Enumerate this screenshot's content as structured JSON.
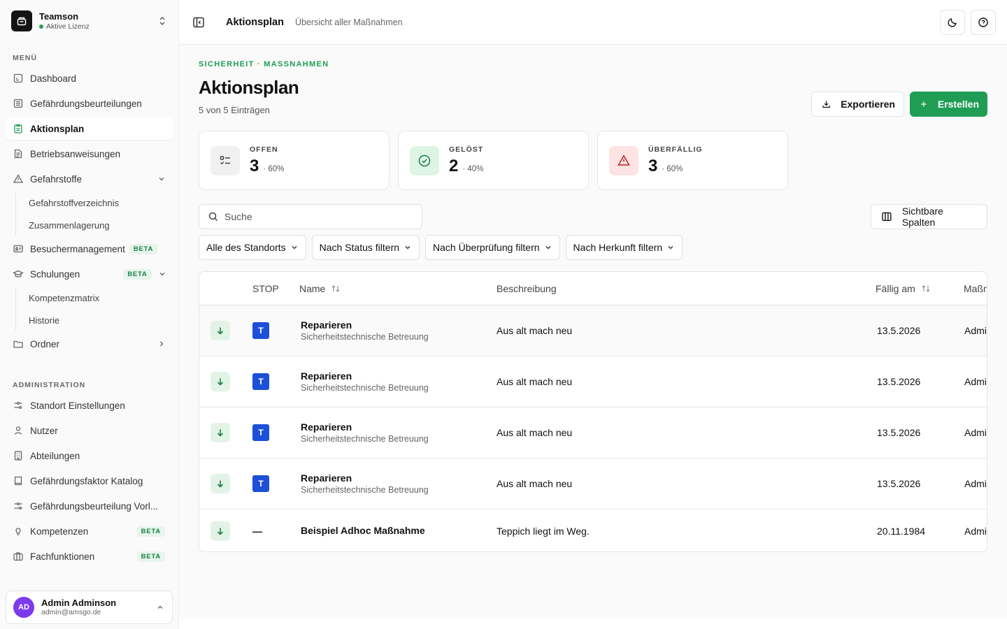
{
  "team": {
    "name": "Teamson",
    "status": "Aktive Lizenz"
  },
  "sidebar": {
    "menu_label": "MENÜ",
    "admin_label": "ADMINISTRATION",
    "menu": [
      {
        "label": "Dashboard",
        "icon": "dashboard-icon"
      },
      {
        "label": "Gefährdungsbeurteilungen",
        "icon": "document-list-icon"
      },
      {
        "label": "Aktionsplan",
        "icon": "clipboard-icon",
        "active": true
      },
      {
        "label": "Betriebsanweisungen",
        "icon": "file-text-icon"
      },
      {
        "label": "Gefahrstoffe",
        "icon": "warning-icon",
        "expanded": true
      },
      {
        "label": "Gefahrstoffverzeichnis"
      },
      {
        "label": "Zusammenlagerung"
      },
      {
        "label": "Besuchermanagement",
        "icon": "id-card-icon",
        "badge": "BETA"
      },
      {
        "label": "Schulungen",
        "icon": "graduation-cap-icon",
        "badge": "BETA",
        "expanded": true
      },
      {
        "label": "Kompetenzmatrix"
      },
      {
        "label": "Historie"
      },
      {
        "label": "Ordner",
        "icon": "folder-icon"
      }
    ],
    "admin": [
      {
        "label": "Standort Einstellungen",
        "icon": "sliders-icon"
      },
      {
        "label": "Nutzer",
        "icon": "user-icon"
      },
      {
        "label": "Abteilungen",
        "icon": "building-icon"
      },
      {
        "label": "Gefährdungsfaktor Katalog",
        "icon": "book-icon"
      },
      {
        "label": "Gefährdungsbeurteilung Vorl...",
        "icon": "sliders-icon"
      },
      {
        "label": "Kompetenzen",
        "icon": "lightbulb-icon",
        "badge": "BETA"
      },
      {
        "label": "Fachfunktionen",
        "icon": "briefcase-icon",
        "badge": "BETA"
      }
    ]
  },
  "user": {
    "initials": "AD",
    "name": "Admin Adminson",
    "email": "admin@amsgo.de",
    "avatar_color": "#7c3aed"
  },
  "header": {
    "title": "Aktionsplan",
    "subtitle": "Übersicht aller Maßnahmen"
  },
  "page": {
    "eyebrow": "SICHERHEIT · MASSNAHMEN",
    "title": "Aktionsplan",
    "count": "5 von 5 Einträgen",
    "export_label": "Exportieren",
    "create_label": "Erstellen",
    "columns_label": "Sichtbare Spalten"
  },
  "stats": [
    {
      "label": "OFFEN",
      "value": "3",
      "pct": "· 60%",
      "icon": "checklist-icon"
    },
    {
      "label": "GELÖST",
      "value": "2",
      "pct": "· 40%",
      "icon": "check-circle-icon"
    },
    {
      "label": "ÜBERFÄLLIG",
      "value": "3",
      "pct": "· 60%",
      "icon": "alert-triangle-icon"
    }
  ],
  "search": {
    "placeholder": "Suche"
  },
  "filters": [
    "Alle des Standorts",
    "Nach Status filtern",
    "Nach Überprüfung filtern",
    "Nach Herkunft filtern"
  ],
  "table": {
    "headers": {
      "stop": "STOP",
      "name": "Name",
      "description": "Beschreibung",
      "due": "Fällig am",
      "measure": "Maßn"
    },
    "rows": [
      {
        "stop": "T",
        "name": "Reparieren",
        "sub": "Sicherheitstechnische Betreuung",
        "description": "Aus alt mach neu",
        "due": "13.5.2026",
        "measure": "Admi"
      },
      {
        "stop": "T",
        "name": "Reparieren",
        "sub": "Sicherheitstechnische Betreuung",
        "description": "Aus alt mach neu",
        "due": "13.5.2026",
        "measure": "Admi"
      },
      {
        "stop": "T",
        "name": "Reparieren",
        "sub": "Sicherheitstechnische Betreuung",
        "description": "Aus alt mach neu",
        "due": "13.5.2026",
        "measure": "Admi"
      },
      {
        "stop": "T",
        "name": "Reparieren",
        "sub": "Sicherheitstechnische Betreuung",
        "description": "Aus alt mach neu",
        "due": "13.5.2026",
        "measure": "Admi"
      },
      {
        "stop": "—",
        "name": "Beispiel Adhoc Maßnahme",
        "sub": "",
        "description": "Teppich liegt im Weg.",
        "due": "20.11.1984",
        "measure": "Admi"
      }
    ]
  },
  "colors": {
    "accent": "#1f9d55",
    "badge_blue": "#1d4fd8"
  }
}
